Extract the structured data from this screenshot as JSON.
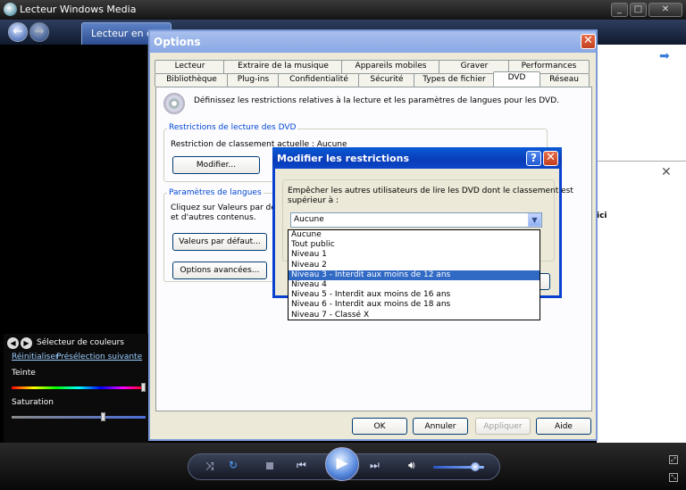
{
  "window": {
    "title": "Lecteur Windows Media"
  },
  "nav": {
    "tab_now_playing": "Lecteur en co"
  },
  "color_panel": {
    "title": "Sélecteur de couleurs",
    "reset_link": "Réinitialiser",
    "next_preset_link": "Présélection suivante",
    "hue_label": "Teinte",
    "hue_value": 1.0,
    "saturation_label": "Saturation",
    "saturation_value": 0.68
  },
  "right_pane": {
    "partial_text": "ici"
  },
  "volume": {
    "level": 0.82
  },
  "options": {
    "title": "Options",
    "tabs_back": [
      "Lecteur",
      "Extraire de la musique",
      "Appareils mobiles",
      "Graver",
      "Performances"
    ],
    "tabs_front": [
      "Bibliothèque",
      "Plug-ins",
      "Confidentialité",
      "Sécurité",
      "Types de fichier",
      "DVD",
      "Réseau"
    ],
    "selected_tab": "DVD",
    "description": "Définissez les restrictions relatives à la lecture et les paramètres de langues pour les DVD.",
    "restrictions_group": "Restrictions de lecture des DVD",
    "current_rating": "Restriction de classement actuelle : Aucune",
    "modify_button": "Modifier...",
    "language_group": "Paramètres de langues",
    "language_text_1": "Cliquez sur Valeurs par défa",
    "language_text_2": "et d'autres contenus.",
    "defaults_button": "Valeurs par défaut...",
    "advanced_button": "Options avancées...",
    "ok": "OK",
    "cancel": "Annuler",
    "apply": "Appliquer",
    "help": "Aide"
  },
  "modify_dialog": {
    "title": "Modifier les restrictions",
    "help_icon": "?",
    "prompt_line1": "Empêcher les autres utilisateurs de lire les DVD dont le classement est",
    "prompt_line2": "supérieur à :",
    "selected_value": "Aucune",
    "options": [
      "Aucune",
      "Tout public",
      "Niveau 1",
      "Niveau 2",
      "Niveau 3 - Interdit aux moins de 12 ans",
      "Niveau 4",
      "Niveau 5 - Interdit aux moins de 16 ans",
      "Niveau 6 - Interdit aux moins de 18 ans",
      "Niveau 7 - Classé X"
    ],
    "highlighted_option": "Niveau 3 - Interdit aux moins de 12 ans"
  }
}
